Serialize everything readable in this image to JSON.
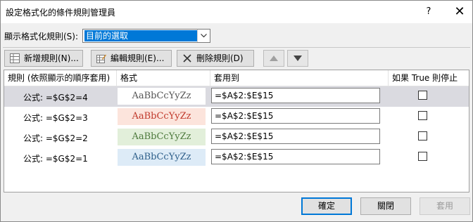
{
  "dialog": {
    "title": "設定格式化的條件規則管理員",
    "help_label": "?",
    "close_label": "✕"
  },
  "show_rules": {
    "label": "顯示格式化規則(S):",
    "selected": "目前的選取"
  },
  "toolbar": {
    "new_rule": "新增規則(N)...",
    "edit_rule": "編輯規則(E)...",
    "delete_rule": "刪除規則(D)",
    "move_up_icon": "arrow-up-icon",
    "move_down_icon": "arrow-down-icon"
  },
  "table": {
    "headers": {
      "rule": "規則 (依照顯示的順序套用)",
      "format": "格式",
      "applies_to": "套用到",
      "stop_if_true": "如果 True 則停止"
    },
    "rows": [
      {
        "rule": "公式: =$G$2=4",
        "sample": "AaBbCcYyZz",
        "fill": "#ffffff",
        "text_color": "#555555",
        "applies_to": "=$A$2:$E$15",
        "stop_if_true": false,
        "selected": true
      },
      {
        "rule": "公式: =$G$2=3",
        "sample": "AaBbCcYyZz",
        "fill": "#fce4dc",
        "text_color": "#c0392b",
        "applies_to": "=$A$2:$E$15",
        "stop_if_true": false,
        "selected": false
      },
      {
        "rule": "公式: =$G$2=2",
        "sample": "AaBbCcYyZz",
        "fill": "#e2efda",
        "text_color": "#4e7a3d",
        "applies_to": "=$A$2:$E$15",
        "stop_if_true": false,
        "selected": false
      },
      {
        "rule": "公式: =$G$2=1",
        "sample": "AaBbCcYyZz",
        "fill": "#ddebf7",
        "text_color": "#2e5f8a",
        "applies_to": "=$A$2:$E$15",
        "stop_if_true": false,
        "selected": false
      }
    ]
  },
  "buttons": {
    "ok": "確定",
    "close": "關閉",
    "apply": "套用"
  },
  "colors": {
    "accent": "#0078d7",
    "selected_row": "#dadae0"
  }
}
